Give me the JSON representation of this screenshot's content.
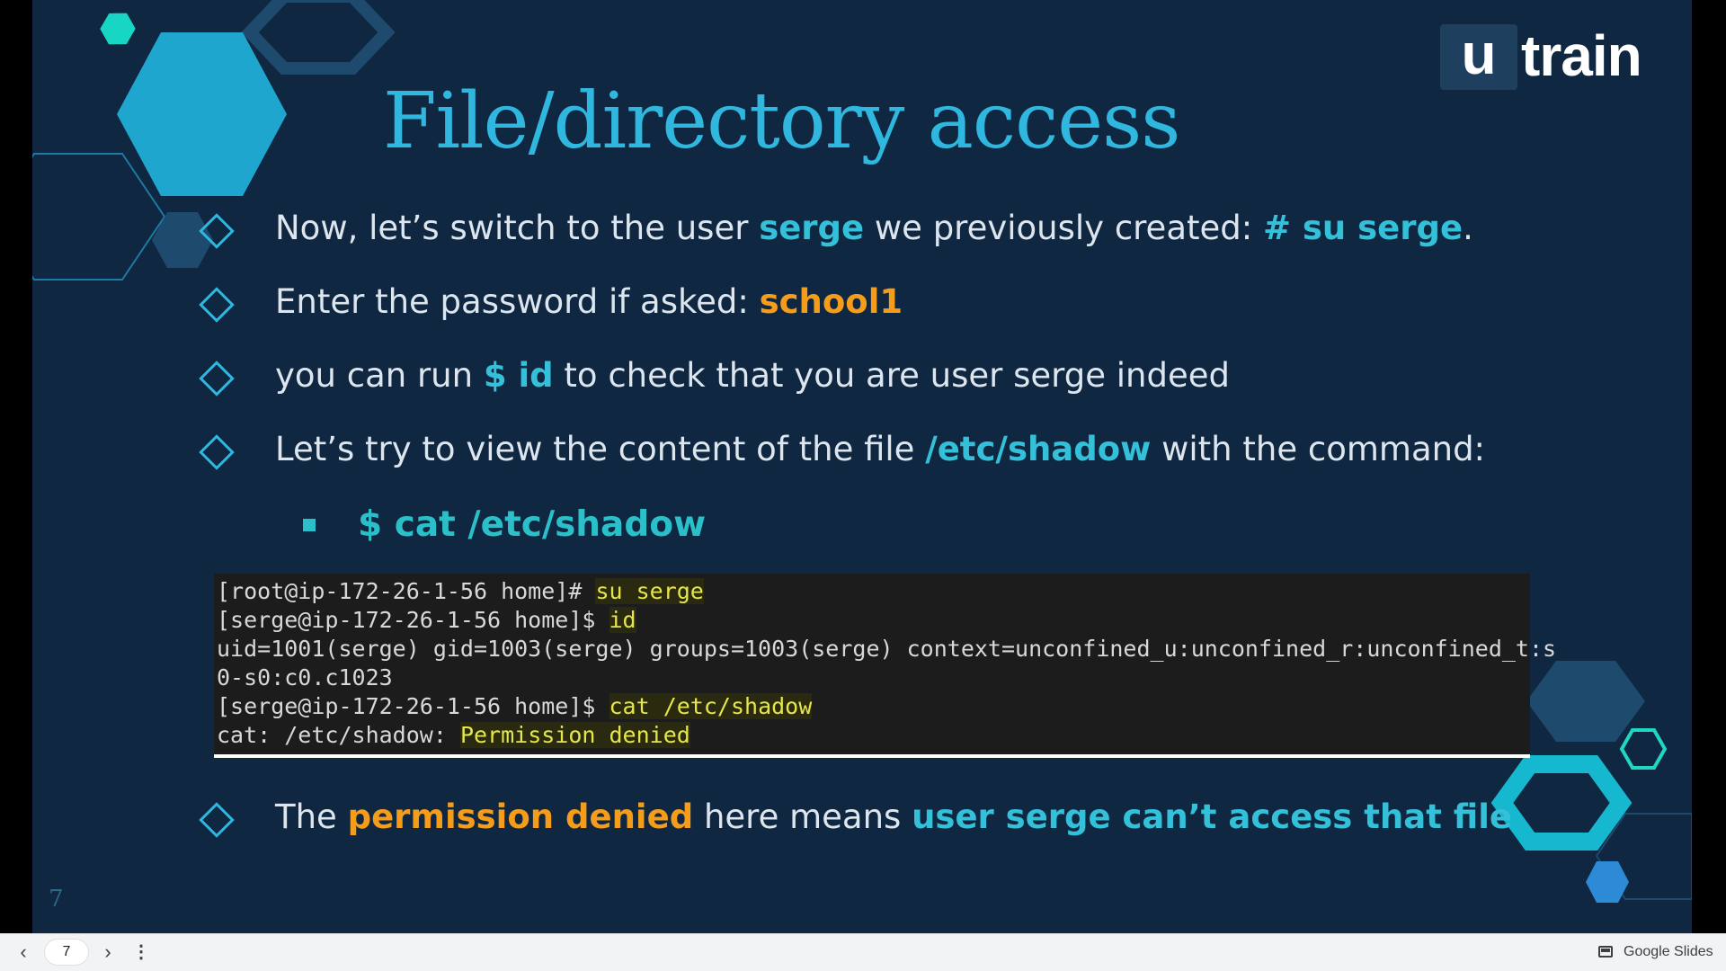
{
  "slide": {
    "logo": {
      "box": "u",
      "text": "train"
    },
    "title": "File/directory access",
    "bullets": [
      {
        "parts": [
          "Now, let’s switch to the user ",
          "serge",
          " we previously created: ",
          "# su serge",
          "."
        ]
      },
      {
        "parts": [
          "Enter the password if asked: ",
          "school1"
        ]
      },
      {
        "parts": [
          "you can run ",
          "$ id",
          " to check that you are user serge indeed"
        ]
      },
      {
        "parts": [
          "Let’s try to view the content of the file ",
          "/etc/shadow",
          " with the command:"
        ]
      },
      {
        "parts": [
          "The ",
          "permission denied",
          " here means ",
          "user serge can’t access that file"
        ]
      }
    ],
    "sub_bullet": "$ cat /etc/shadow",
    "terminal": {
      "lines": [
        {
          "prompt": "[root@ip-172-26-1-56 home]# ",
          "cmd": "su serge"
        },
        {
          "prompt": "[serge@ip-172-26-1-56 home]$ ",
          "cmd": "id"
        },
        {
          "plain": "uid=1001(serge) gid=1003(serge) groups=1003(serge) context=unconfined_u:unconfined_r:unconfined_t:s"
        },
        {
          "plain": "0-s0:c0.c1023"
        },
        {
          "prompt": "[serge@ip-172-26-1-56 home]$ ",
          "cmd": "cat /etc/shadow"
        },
        {
          "prompt": "cat: /etc/shadow: ",
          "cmd": "Permission denied"
        }
      ]
    },
    "page_number": "7"
  },
  "bottom_bar": {
    "prev_icon": "chevron-left-icon",
    "current_page": "7",
    "next_icon": "chevron-right-icon",
    "menu_icon": "more-vert-icon",
    "app_label": "Google Slides"
  },
  "colors": {
    "slide_bg": "#0f2740",
    "title": "#2fb7df",
    "highlight_teal": "#34c0d8",
    "highlight_orange": "#f59c1a",
    "terminal_highlight": "#e6e64a"
  }
}
